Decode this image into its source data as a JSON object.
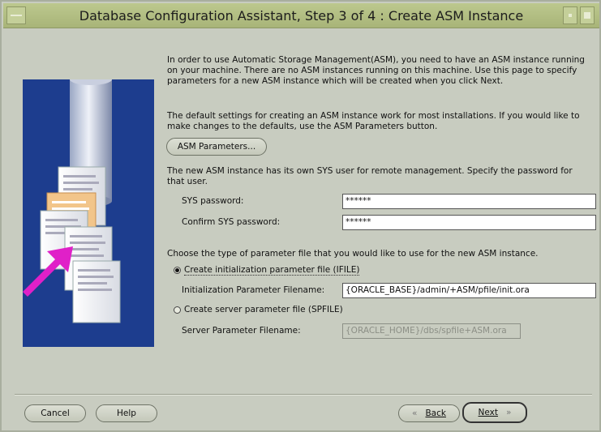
{
  "window": {
    "title": "Database Configuration Assistant, Step 3 of 4 : Create ASM Instance"
  },
  "intro": {
    "p1": "In order to use Automatic Storage Management(ASM), you need to have an ASM instance running on your machine. There are no ASM instances running on this machine. Use this page to specify parameters for a new ASM instance which will be created when you click Next.",
    "p2": "The default settings for creating an ASM instance work for most installations. If you would like to make changes to the defaults, use the ASM Parameters button."
  },
  "asm_params_button": "ASM Parameters...",
  "sys": {
    "text": "The new ASM instance has its own SYS user for remote management. Specify the password for that user.",
    "password_label": "SYS password:",
    "password_value": "******",
    "confirm_label": "Confirm SYS password:",
    "confirm_value": "******"
  },
  "param_file": {
    "prompt": "Choose the type of parameter file that you would like to use for the new ASM instance.",
    "ifile_label": "Create initialization parameter file (IFILE)",
    "ifile_selected": true,
    "ifile_filename_label": "Initialization Parameter Filename:",
    "ifile_filename_value": "{ORACLE_BASE}/admin/+ASM/pfile/init.ora",
    "spfile_label": "Create server parameter file (SPFILE)",
    "spfile_filename_label": "Server Parameter Filename:",
    "spfile_filename_value": "{ORACLE_HOME}/dbs/spfile+ASM.ora"
  },
  "footer": {
    "cancel": "Cancel",
    "help": "Help",
    "back": "Back",
    "next": "Next"
  },
  "icons": {
    "illustration": "database-documents-illustration",
    "back": "double-chevron-left-icon",
    "next": "double-chevron-right-icon"
  },
  "colors": {
    "titlebar": "#a8b478",
    "background": "#c8ccc0",
    "illustration_bg": "#1d3d8e",
    "arrow": "#e020c8"
  }
}
